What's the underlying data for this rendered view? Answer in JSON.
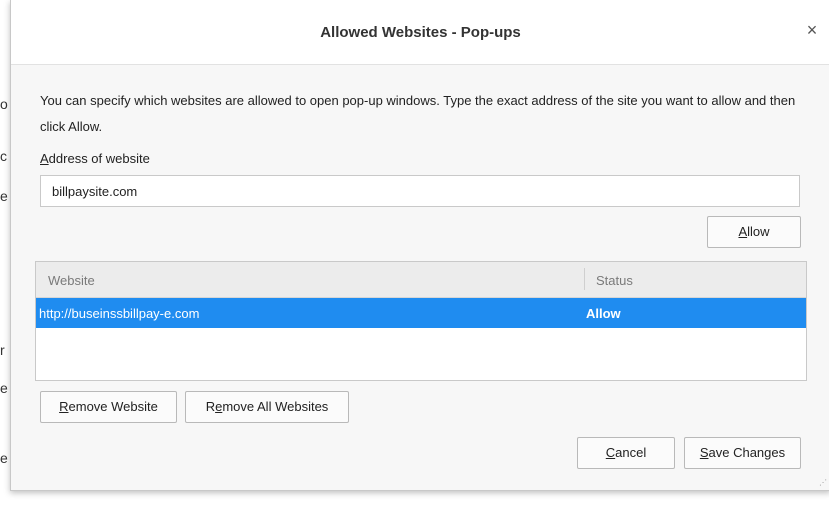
{
  "dialog": {
    "title": "Allowed Websites - Pop-ups",
    "close_glyph": "×",
    "description": "You can specify which websites are allowed to open pop-up windows. Type the exact address of the site you want to allow and then click Allow.",
    "address_label": {
      "accel": "A",
      "rest": "ddress of website"
    },
    "address_value": "billpaysite.com",
    "allow_button": {
      "accel": "A",
      "rest": "llow"
    },
    "table": {
      "columns": [
        "Website",
        "Status"
      ],
      "rows": [
        {
          "website": "http://buseinssbillpay-e.com",
          "status": "Allow",
          "selected": true
        }
      ]
    },
    "remove_website_button": {
      "accel": "R",
      "rest": "emove Website"
    },
    "remove_all_button": {
      "pre": "R",
      "accel": "e",
      "rest": "move All Websites"
    },
    "cancel_button": {
      "accel": "C",
      "rest": "ancel"
    },
    "save_button": {
      "accel": "S",
      "rest": "ave Changes"
    }
  },
  "colors": {
    "selection": "#1f8cf0",
    "title_bg": "#ffffff",
    "dialog_bg": "#f7f7f7"
  }
}
